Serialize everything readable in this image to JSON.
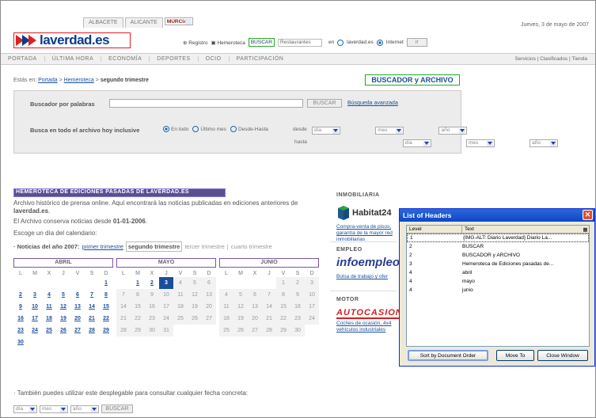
{
  "header": {
    "city_tabs": [
      "ALBACETE",
      "ALICANTE",
      "MURCIA"
    ],
    "selected_city": "MURCIA",
    "date": "Jueves, 3 de mayo de 2007",
    "logo_text": "laverdad.es",
    "registro": "Registro",
    "hemeroteca": "Hemeroteca",
    "buscar": "BUSCAR",
    "restaurantes": "Restaurantes",
    "en": "en",
    "laverdad_opt": "laverdad.es",
    "internet_opt": "Internet",
    "go": "ir"
  },
  "nav": {
    "items": [
      "PORTADA",
      "ÚLTIMA HORA",
      "ECONOMÍA",
      "DEPORTES",
      "OCIO",
      "PARTICIPACIÓN"
    ],
    "right": "Servicios | Clasificados | Tienda"
  },
  "breadcrumb": {
    "prefix": "Estás en:",
    "link1": "Portada",
    "sep": ">",
    "link2": "Hemeroteca",
    "current": "segundo trimestre"
  },
  "search": {
    "title": "BUSCADOR y ARCHIVO",
    "keyword_label": "Buscador por palabras",
    "buscar_btn": "BUSCAR",
    "advanced_link": "Búsqueda avanzada",
    "archive_label": "Busca en todo el archivo hoy inclusive",
    "opt_all": "En todo",
    "opt_month": "Último mes",
    "opt_since": "Desde-Hasta",
    "desde": "desde",
    "hasta": "hasta",
    "dia": "día",
    "mes": "mes",
    "ano": "año"
  },
  "hemeroteca": {
    "heading": "HEMEROTECA DE EDICIONES PASADAS DE LAVERDAD.ES",
    "intro_prefix": "Archivo histórico de prensa online. Aquí encontrará las noticias publicadas en ediciones anteriores de ",
    "intro_site": "laverdad.es",
    "intro_suffix": ".",
    "since_prefix": "El Archivo conserva noticias desde ",
    "since_date": "01-01-2006",
    "since_suffix": ".",
    "choose": "Escoge un día del calendario:",
    "trim_label": "· Noticias del año 2007:",
    "trim1": "primer trimestre",
    "trim2": "segundo trimestre",
    "trim3": "tercer trimestre",
    "trim4": "cuarto trimestre",
    "trim_sep": "|",
    "weekdays": [
      "L",
      "M",
      "X",
      "J",
      "V",
      "S",
      "D"
    ],
    "months": [
      {
        "name": "ABRIL",
        "days": [
          "",
          "",
          "",
          "",
          "",
          "",
          "1",
          "2",
          "3",
          "4",
          "5",
          "6",
          "7",
          "8",
          "9",
          "10",
          "11",
          "12",
          "13",
          "14",
          "15",
          "16",
          "17",
          "18",
          "19",
          "20",
          "21",
          "22",
          "23",
          "24",
          "25",
          "26",
          "27",
          "28",
          "29",
          "30"
        ]
      },
      {
        "name": "MAYO",
        "days": [
          "",
          "1",
          "2",
          "3",
          "4",
          "5",
          "6",
          "7",
          "8",
          "9",
          "10",
          "11",
          "12",
          "13",
          "14",
          "15",
          "16",
          "17",
          "18",
          "19",
          "20",
          "21",
          "22",
          "23",
          "24",
          "25",
          "26",
          "27",
          "28",
          "29",
          "30",
          "31"
        ]
      },
      {
        "name": "JUNIO",
        "days": [
          "",
          "",
          "",
          "",
          "1",
          "2",
          "3",
          "4",
          "5",
          "6",
          "7",
          "8",
          "9",
          "10",
          "11",
          "12",
          "13",
          "14",
          "15",
          "16",
          "17",
          "18",
          "19",
          "20",
          "21",
          "22",
          "23",
          "24",
          "25",
          "26",
          "27",
          "28",
          "29",
          "30"
        ]
      }
    ],
    "also": "· También puedes utilizar este desplegable para consultar cualquier fecha concreta:",
    "buscar_btn": "BUSCAR"
  },
  "sidebar": {
    "inmobiliaria": "INMOBILIARIA",
    "habitat": "Habitat24",
    "habitat_link": "Compra-venta de pisos, garantía de la mayor red inmobiliarias",
    "empleo": "EMPLEO",
    "infoempleo": "infoempleo",
    "empleo_link": "Bolsa de trabajo y ofer",
    "motor": "MOTOR",
    "autocasion": "AUTOCASION",
    "motor_link": "Coches de ocasión, 4x4 vehículos industriales"
  },
  "dialog": {
    "title": "List of Headers",
    "col_level": "Level",
    "col_text": "Text",
    "rows": [
      {
        "level": "1",
        "text": "{IMG-ALT: Diario Laverdad} Diario La..."
      },
      {
        "level": "2",
        "text": "BUSCAR"
      },
      {
        "level": "2",
        "text": "BUSCADOR y ARCHIVO"
      },
      {
        "level": "3",
        "text": "Hemeroteca de Ediciones pasadas de..."
      },
      {
        "level": "4",
        "text": "abril"
      },
      {
        "level": "4",
        "text": "mayo"
      },
      {
        "level": "4",
        "text": "junio"
      }
    ],
    "btn_sort": "Sort by Document Order",
    "btn_move": "Move To",
    "btn_close": "Close Window",
    "close_glyph": "✕"
  }
}
